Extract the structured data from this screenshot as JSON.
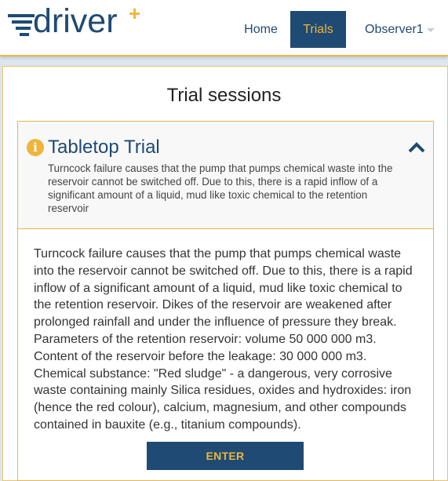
{
  "brand": {
    "name": "driver",
    "plus": "+"
  },
  "nav": {
    "home": "Home",
    "trials": "Trials",
    "user": "Observer1"
  },
  "page": {
    "title": "Trial sessions"
  },
  "trial": {
    "title": "Tabletop Trial",
    "summary": "Turncock failure causes that the pump that pumps chemical waste into the reservoir cannot be switched off. Due to this, there is a rapid inflow of a significant amount of a liquid, mud like toxic chemical to the retention reservoir",
    "description": "Turncock failure causes that the pump that pumps chemical waste into the reservoir cannot be switched off. Due to this, there is a rapid inflow of a significant amount of a liquid, mud like toxic chemical to the retention reservoir. Dikes of the reservoir are weakened after prolonged rainfall and under the influence of pressure they break. Parameters of the retention reservoir: volume 50 000 000 m3. Content of the reservoir before the leakage: 30 000 000 m3. Chemical substance: \"Red sludge\" - a dangerous, very corrosive waste containing mainly Silica residues, oxides and hydroxides: iron (hence the red colour), calcium, magnesium, and other compounds contained in bauxite (e.g., titanium compounds).",
    "enter_label": "ENTER",
    "info_icon": "info-circle-icon",
    "collapse_icon": "chevron-up-icon"
  },
  "colors": {
    "primary": "#1f4a73",
    "accent": "#f0b43c",
    "border": "#e8b64a",
    "header_bg": "#f8f8f8"
  }
}
